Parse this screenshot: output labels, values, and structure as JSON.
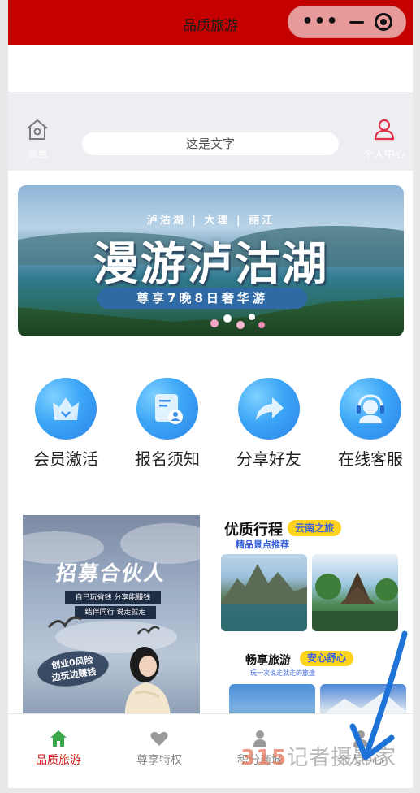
{
  "titlebar": {
    "title": "品质旅游",
    "capsule_dots": "•••"
  },
  "header": {
    "message_label": "消息",
    "search_placeholder": "这是文字",
    "user_label": "个人中心"
  },
  "banner": {
    "subtitle": "泸沽湖 | 大理 | 丽江",
    "headline": "漫游泸沽湖",
    "ribbon": "尊享7晚8日奢华游"
  },
  "features": [
    {
      "label": "会员激活",
      "icon": "crown-icon"
    },
    {
      "label": "报名须知",
      "icon": "document-user-icon"
    },
    {
      "label": "分享好友",
      "icon": "share-arrow-icon"
    },
    {
      "label": "在线客服",
      "icon": "headset-icon"
    }
  ],
  "promo_left": {
    "title": "招募合伙人",
    "line1": "自己玩省钱 分享能赚钱",
    "line2": "结伴同行 说走就走",
    "badge_line1": "创业0风险",
    "badge_line2": "边玩边赚钱"
  },
  "promo_right": {
    "title": "优质行程",
    "tag": "云南之旅",
    "subtitle": "精品景点推荐",
    "title2": "畅享旅游",
    "tag2": "安心舒心",
    "subtitle2": "玩一次说走就走的旅途"
  },
  "tabs": [
    {
      "label": "品质旅游",
      "icon": "home-icon",
      "active": true
    },
    {
      "label": "尊享特权",
      "icon": "heart-icon",
      "active": false
    },
    {
      "label": "积分商城",
      "icon": "gift-icon",
      "active": false
    },
    {
      "label": "个人中心",
      "icon": "user-icon",
      "active": false
    }
  ],
  "watermark": {
    "number": "315",
    "text": "记者摄影家"
  },
  "colors": {
    "titlebar": "#c40000",
    "accent_red": "#d11b1b",
    "active_green": "#3aa84a",
    "feature_blue": "#3ba6f6",
    "tag_yellow": "#ffd21f"
  }
}
